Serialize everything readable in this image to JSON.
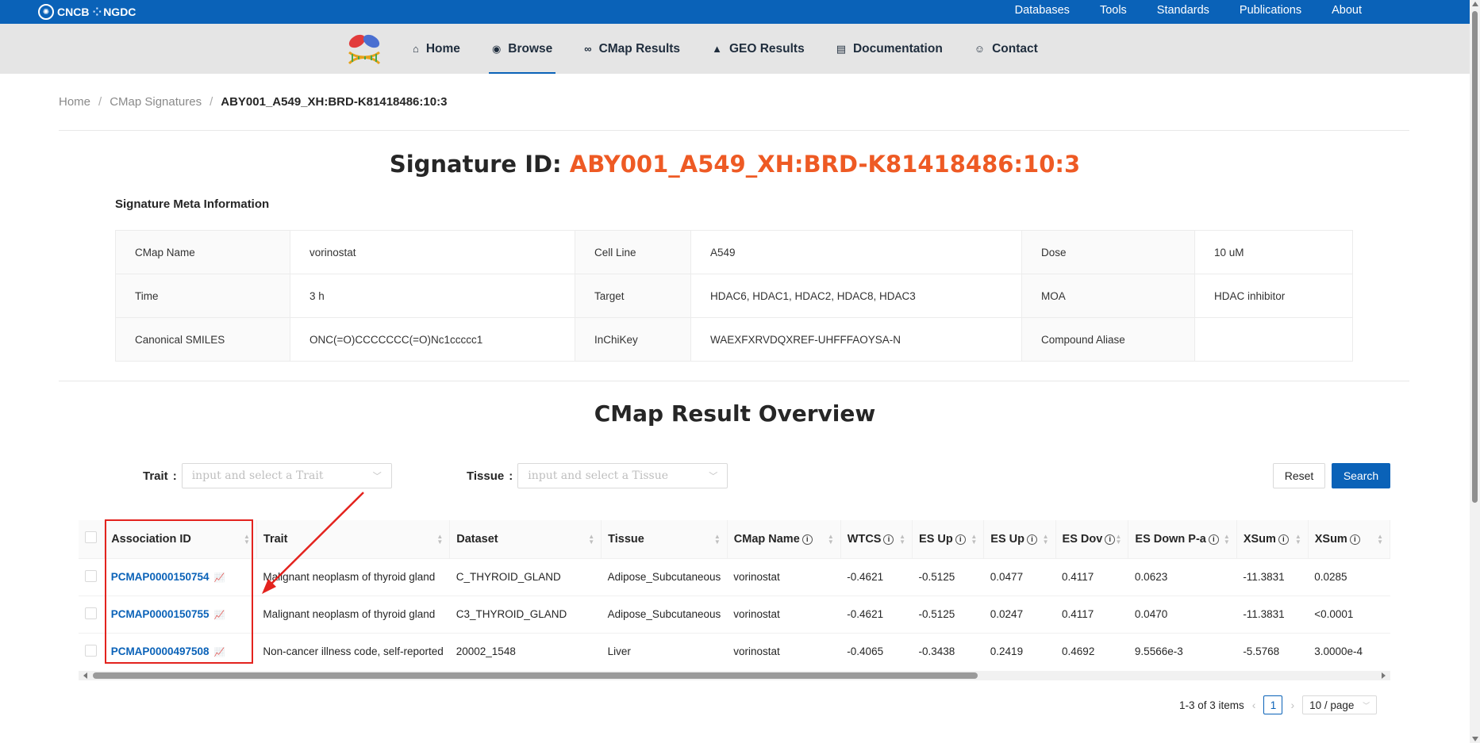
{
  "topbar": {
    "brand_left": "CNCB",
    "brand_right": "NGDC",
    "links": [
      "Databases",
      "Tools",
      "Standards",
      "Publications",
      "About"
    ]
  },
  "nav": {
    "items": [
      {
        "label": "Home",
        "icon": "home-icon"
      },
      {
        "label": "Browse",
        "icon": "eye-icon"
      },
      {
        "label": "CMap Results",
        "icon": "binoculars-icon"
      },
      {
        "label": "GEO Results",
        "icon": "mountain-icon"
      },
      {
        "label": "Documentation",
        "icon": "document-icon"
      },
      {
        "label": "Contact",
        "icon": "contact-icon"
      }
    ],
    "active": "Browse"
  },
  "breadcrumb": {
    "home": "Home",
    "section": "CMap Signatures",
    "current": "ABY001_A549_XH:BRD-K81418486:10:3",
    "sep": "/"
  },
  "signature": {
    "prefix": "Signature ID: ",
    "id": "ABY001_A549_XH:BRD-K81418486:10:3"
  },
  "meta": {
    "heading": "Signature Meta Information",
    "rows": [
      [
        {
          "k": "CMap Name",
          "v": "vorinostat"
        },
        {
          "k": "Cell Line",
          "v": "A549"
        },
        {
          "k": "Dose",
          "v": "10 uM"
        }
      ],
      [
        {
          "k": "Time",
          "v": "3 h"
        },
        {
          "k": "Target",
          "v": "HDAC6, HDAC1, HDAC2, HDAC8, HDAC3"
        },
        {
          "k": "MOA",
          "v": "HDAC inhibitor"
        }
      ],
      [
        {
          "k": "Canonical SMILES",
          "v": "ONC(=O)CCCCCCC(=O)Nc1ccccc1"
        },
        {
          "k": "InChiKey",
          "v": "WAEXFXRVDQXREF-UHFFFAOYSA-N"
        },
        {
          "k": "Compound Aliase",
          "v": ""
        }
      ]
    ]
  },
  "overview": {
    "title": "CMap Result Overview",
    "trait_label": "Trait",
    "trait_placeholder": "input and select a Trait",
    "tissue_label": "Tissue",
    "tissue_placeholder": "input and select a Tissue",
    "reset": "Reset",
    "search": "Search"
  },
  "table": {
    "headers": [
      "Association ID",
      "Trait",
      "Dataset",
      "Tissue",
      "CMap Name",
      "WTCS",
      "ES Up",
      "ES Up",
      "ES Dov",
      "ES Down P-a",
      "XSum",
      "XSum"
    ],
    "rows": [
      [
        "PCMAP0000150754",
        "Malignant neoplasm of thyroid gland",
        "C_THYROID_GLAND",
        "Adipose_Subcutaneous",
        "vorinostat",
        "-0.4621",
        "-0.5125",
        "0.0477",
        "0.4117",
        "0.0623",
        "-11.3831",
        "0.0285"
      ],
      [
        "PCMAP0000150755",
        "Malignant neoplasm of thyroid gland",
        "C3_THYROID_GLAND",
        "Adipose_Subcutaneous",
        "vorinostat",
        "-0.4621",
        "-0.5125",
        "0.0247",
        "0.4117",
        "0.0470",
        "-11.3831",
        "<0.0001"
      ],
      [
        "PCMAP0000497508",
        "Non-cancer illness code, self-reported",
        "20002_1548",
        "Liver",
        "vorinostat",
        "-0.4065",
        "-0.3438",
        "0.2419",
        "0.4692",
        "9.5566e-3",
        "-5.5768",
        "3.0000e-4"
      ]
    ]
  },
  "pager": {
    "summary": "1-3 of 3 items",
    "page": "1",
    "size": "10 / page"
  },
  "colors": {
    "primary": "#0a62b8",
    "accent": "#ee5a24",
    "annotation": "#e3231e"
  }
}
